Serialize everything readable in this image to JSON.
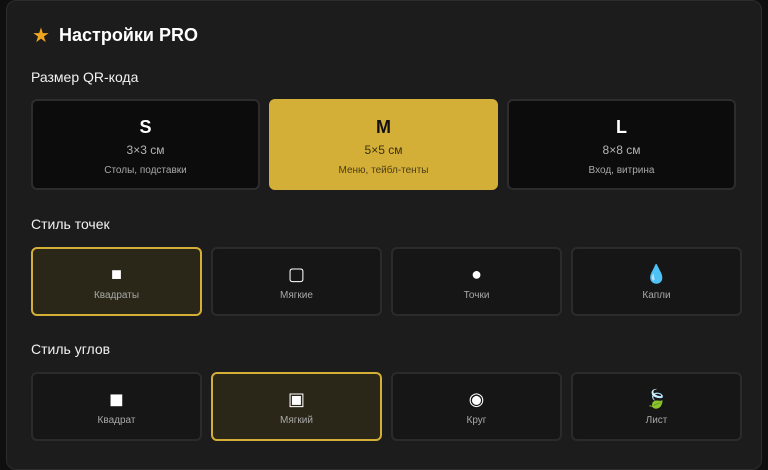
{
  "header": {
    "star_icon": "★",
    "title": "Настройки PRO",
    "accent_color": "#d4af37"
  },
  "size_section": {
    "label": "Размер QR-кода",
    "options": [
      {
        "letter": "S",
        "dimensions": "3×3 см",
        "description": "Столы, подставки",
        "selected": false
      },
      {
        "letter": "M",
        "dimensions": "5×5 см",
        "description": "Меню, тейбл-тенты",
        "selected": true
      },
      {
        "letter": "L",
        "dimensions": "8×8 см",
        "description": "Вход, витрина",
        "selected": false
      }
    ]
  },
  "dot_style_section": {
    "label": "Стиль точек",
    "options": [
      {
        "icon": "■",
        "icon_name": "square-icon",
        "label": "Квадраты",
        "selected": true
      },
      {
        "icon": "▢",
        "icon_name": "rounded-square-icon",
        "label": "Мягкие",
        "selected": false
      },
      {
        "icon": "●",
        "icon_name": "dot-icon",
        "label": "Точки",
        "selected": false
      },
      {
        "icon": "💧",
        "icon_name": "droplet-icon",
        "label": "Капли",
        "selected": false
      }
    ]
  },
  "corner_style_section": {
    "label": "Стиль углов",
    "options": [
      {
        "icon": "◼",
        "icon_name": "square-corner-icon",
        "label": "Квадрат",
        "selected": false
      },
      {
        "icon": "▣",
        "icon_name": "soft-corner-icon",
        "label": "Мягкий",
        "selected": true
      },
      {
        "icon": "◉",
        "icon_name": "circle-corner-icon",
        "label": "Круг",
        "selected": false
      },
      {
        "icon": "🍃",
        "icon_name": "leaf-icon",
        "label": "Лист",
        "selected": false
      }
    ]
  }
}
